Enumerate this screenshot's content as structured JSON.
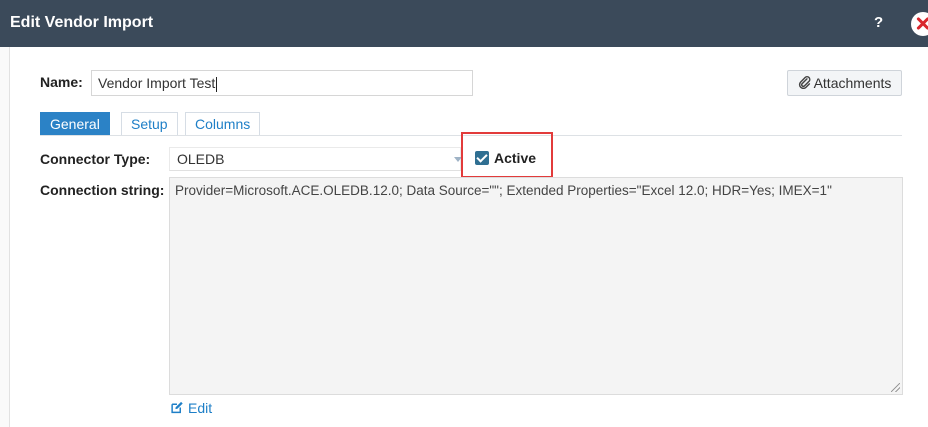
{
  "dialog": {
    "title": "Edit Vendor Import",
    "help_label": "?"
  },
  "name": {
    "label": "Name:",
    "value": "Vendor Import Test"
  },
  "attachments_label": "Attachments",
  "tabs": [
    {
      "label": "General",
      "active": true
    },
    {
      "label": "Setup",
      "active": false
    },
    {
      "label": "Columns",
      "active": false
    }
  ],
  "connector_type": {
    "label": "Connector Type:",
    "value": "OLEDB"
  },
  "active": {
    "label": "Active",
    "checked": true
  },
  "connection_string": {
    "label": "Connection string:",
    "value": "Provider=Microsoft.ACE.OLEDB.12.0; Data Source=\"\"; Extended Properties=\"Excel 12.0; HDR=Yes; IMEX=1\""
  },
  "edit_label": "Edit",
  "colors": {
    "title_bar": "#3b4a5a",
    "tab_active": "#2b82c6",
    "link": "#1e7fc7",
    "highlight_box": "#e23b3b",
    "checkbox": "#2f6f92",
    "close": "#d9262d"
  },
  "icons": {
    "help": "help-icon",
    "close": "close-icon",
    "attachments": "paperclip-icon",
    "dropdown": "chevron-down-icon",
    "edit": "pencil-edit-icon"
  }
}
